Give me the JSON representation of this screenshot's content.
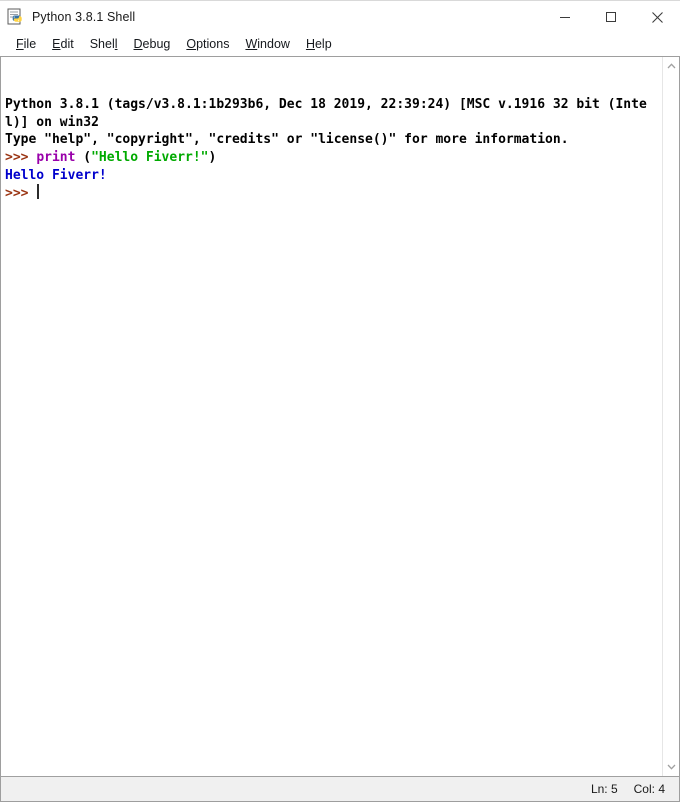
{
  "window": {
    "title": "Python 3.8.1 Shell",
    "icon": "python-idle-icon",
    "controls": {
      "minimize": "minimize-button",
      "maximize": "maximize-button",
      "close": "close-button"
    }
  },
  "menu": {
    "items": [
      {
        "label": "File",
        "pre": "",
        "acc": "F",
        "post": "ile"
      },
      {
        "label": "Edit",
        "pre": "",
        "acc": "E",
        "post": "dit"
      },
      {
        "label": "Shell",
        "pre": "Shel",
        "acc": "l",
        "post": ""
      },
      {
        "label": "Debug",
        "pre": "",
        "acc": "D",
        "post": "ebug"
      },
      {
        "label": "Options",
        "pre": "",
        "acc": "O",
        "post": "ptions"
      },
      {
        "label": "Window",
        "pre": "",
        "acc": "W",
        "post": "indow"
      },
      {
        "label": "Help",
        "pre": "",
        "acc": "H",
        "post": "elp"
      }
    ]
  },
  "shell": {
    "banner_line1": "Python 3.8.1 (tags/v3.8.1:1b293b6, Dec 18 2019, 22:39:24) [MSC v.1916 32 bit (Intel)] on win32",
    "banner_line2": "Type \"help\", \"copyright\", \"credits\" or \"license()\" for more information.",
    "prompt": ">>> ",
    "input_keyword": "print",
    "input_space": " ",
    "input_open": "(",
    "input_string": "\"Hello Fiverr!\"",
    "input_close": ")",
    "output": "Hello Fiverr!",
    "current_prompt": ">>> ",
    "colors": {
      "prompt": "#9a3412",
      "keyword": "#9900aa",
      "string": "#00aa00",
      "output": "#0000cc",
      "text": "#000000",
      "background": "#ffffff"
    }
  },
  "scrollbar": {
    "up_arrow": "scroll-up-arrow",
    "down_arrow": "scroll-down-arrow"
  },
  "statusbar": {
    "line": "Ln: 5",
    "column": "Col: 4"
  }
}
